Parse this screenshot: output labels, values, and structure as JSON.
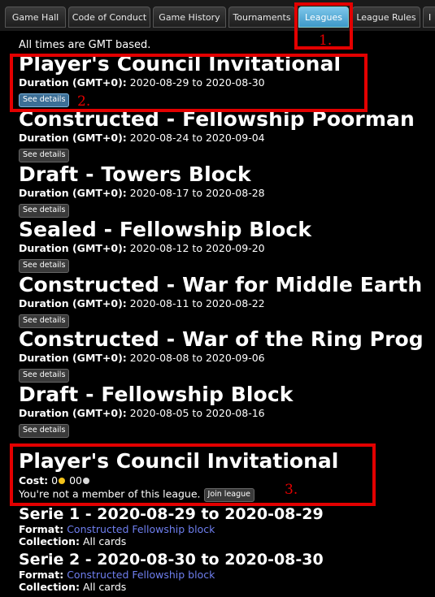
{
  "tabs": [
    {
      "label": "Game Hall"
    },
    {
      "label": "Code of Conduct"
    },
    {
      "label": "Game History"
    },
    {
      "label": "Tournaments"
    },
    {
      "label": "Leagues"
    },
    {
      "label": "League Rules"
    },
    {
      "label": "I"
    }
  ],
  "notice": "All times are GMT based.",
  "duration_label": "Duration (GMT+0):",
  "see_details_label": "See details",
  "leagues": [
    {
      "name": "Player's Council Invitational",
      "start": "2020-08-29",
      "end": "2020-08-30"
    },
    {
      "name": "Constructed - Fellowship Poorman",
      "start": "2020-08-24",
      "end": "2020-09-04"
    },
    {
      "name": "Draft - Towers Block",
      "start": "2020-08-17",
      "end": "2020-08-28"
    },
    {
      "name": "Sealed - Fellowship Block",
      "start": "2020-08-12",
      "end": "2020-09-20"
    },
    {
      "name": "Constructed - War for Middle Earth",
      "start": "2020-08-11",
      "end": "2020-08-22"
    },
    {
      "name": "Constructed - War of the Ring Prog",
      "start": "2020-08-08",
      "end": "2020-09-06"
    },
    {
      "name": "Draft - Fellowship Block",
      "start": "2020-08-05",
      "end": "2020-08-16"
    }
  ],
  "to_word": "to",
  "detail": {
    "title": "Player's Council Invitational",
    "cost_label": "Cost:",
    "cost_gold": "0",
    "cost_silver": "00",
    "membership_text": "You're not a member of this league.",
    "join_label": "Join league"
  },
  "series": [
    {
      "title": "Serie 1 - 2020-08-29 to 2020-08-29",
      "format_label": "Format:",
      "format": "Constructed Fellowship block",
      "collection_label": "Collection:",
      "collection": "All cards"
    },
    {
      "title": "Serie 2 - 2020-08-30 to 2020-08-30",
      "format_label": "Format:",
      "format": "Constructed Fellowship block",
      "collection_label": "Collection:",
      "collection": "All cards"
    }
  ],
  "annotations": [
    {
      "label": "1."
    },
    {
      "label": "2."
    },
    {
      "label": "3."
    }
  ],
  "colors": {
    "annotation_red": "#e30000",
    "active_tab": "#4aa6d6",
    "link": "#6f7ff0",
    "gold_coin": "#f2c21b",
    "silver_coin": "#d8d8d8"
  }
}
